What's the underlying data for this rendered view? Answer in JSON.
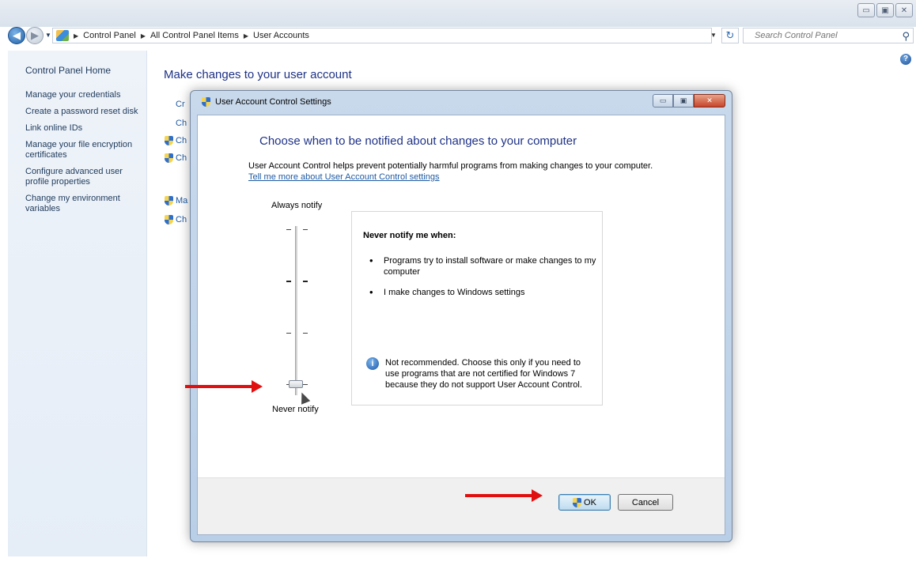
{
  "window": {
    "controls": [
      "▭",
      "▣",
      "✕"
    ]
  },
  "addressbar": {
    "breadcrumb": [
      "Control Panel",
      "All Control Panel Items",
      "User Accounts"
    ],
    "search_placeholder": "Search Control Panel"
  },
  "sidebar": {
    "home": "Control Panel Home",
    "tasks": [
      "Manage your credentials",
      "Create a password reset disk",
      "Link online IDs",
      "Manage your file encryption certificates",
      "Configure advanced user profile properties",
      "Change my environment variables"
    ]
  },
  "main": {
    "title": "Make changes to your user account",
    "partial_links": [
      "Cr",
      "Ch",
      "Ch",
      "Ch",
      "Ma",
      "Ch"
    ]
  },
  "dialog": {
    "title": "User Account Control Settings",
    "heading": "Choose when to be notified about changes to your computer",
    "description": "User Account Control helps prevent potentially harmful programs from making changes to your computer.",
    "learn_more": "Tell me more about User Account Control settings",
    "slider": {
      "top_label": "Always notify",
      "bottom_label": "Never notify",
      "levels": 4,
      "selected_level": 1
    },
    "info": {
      "title": "Never notify me when:",
      "bullets": [
        "Programs try to install software or make changes to my computer",
        "I make changes to Windows settings"
      ],
      "note": "Not recommended. Choose this only if you need to use programs that are not certified for Windows 7 because they do not support User Account Control."
    },
    "buttons": {
      "ok": "OK",
      "cancel": "Cancel"
    }
  },
  "colors": {
    "heading": "#1e3287",
    "link": "#1e5aa3",
    "arrow": "#e01010"
  }
}
